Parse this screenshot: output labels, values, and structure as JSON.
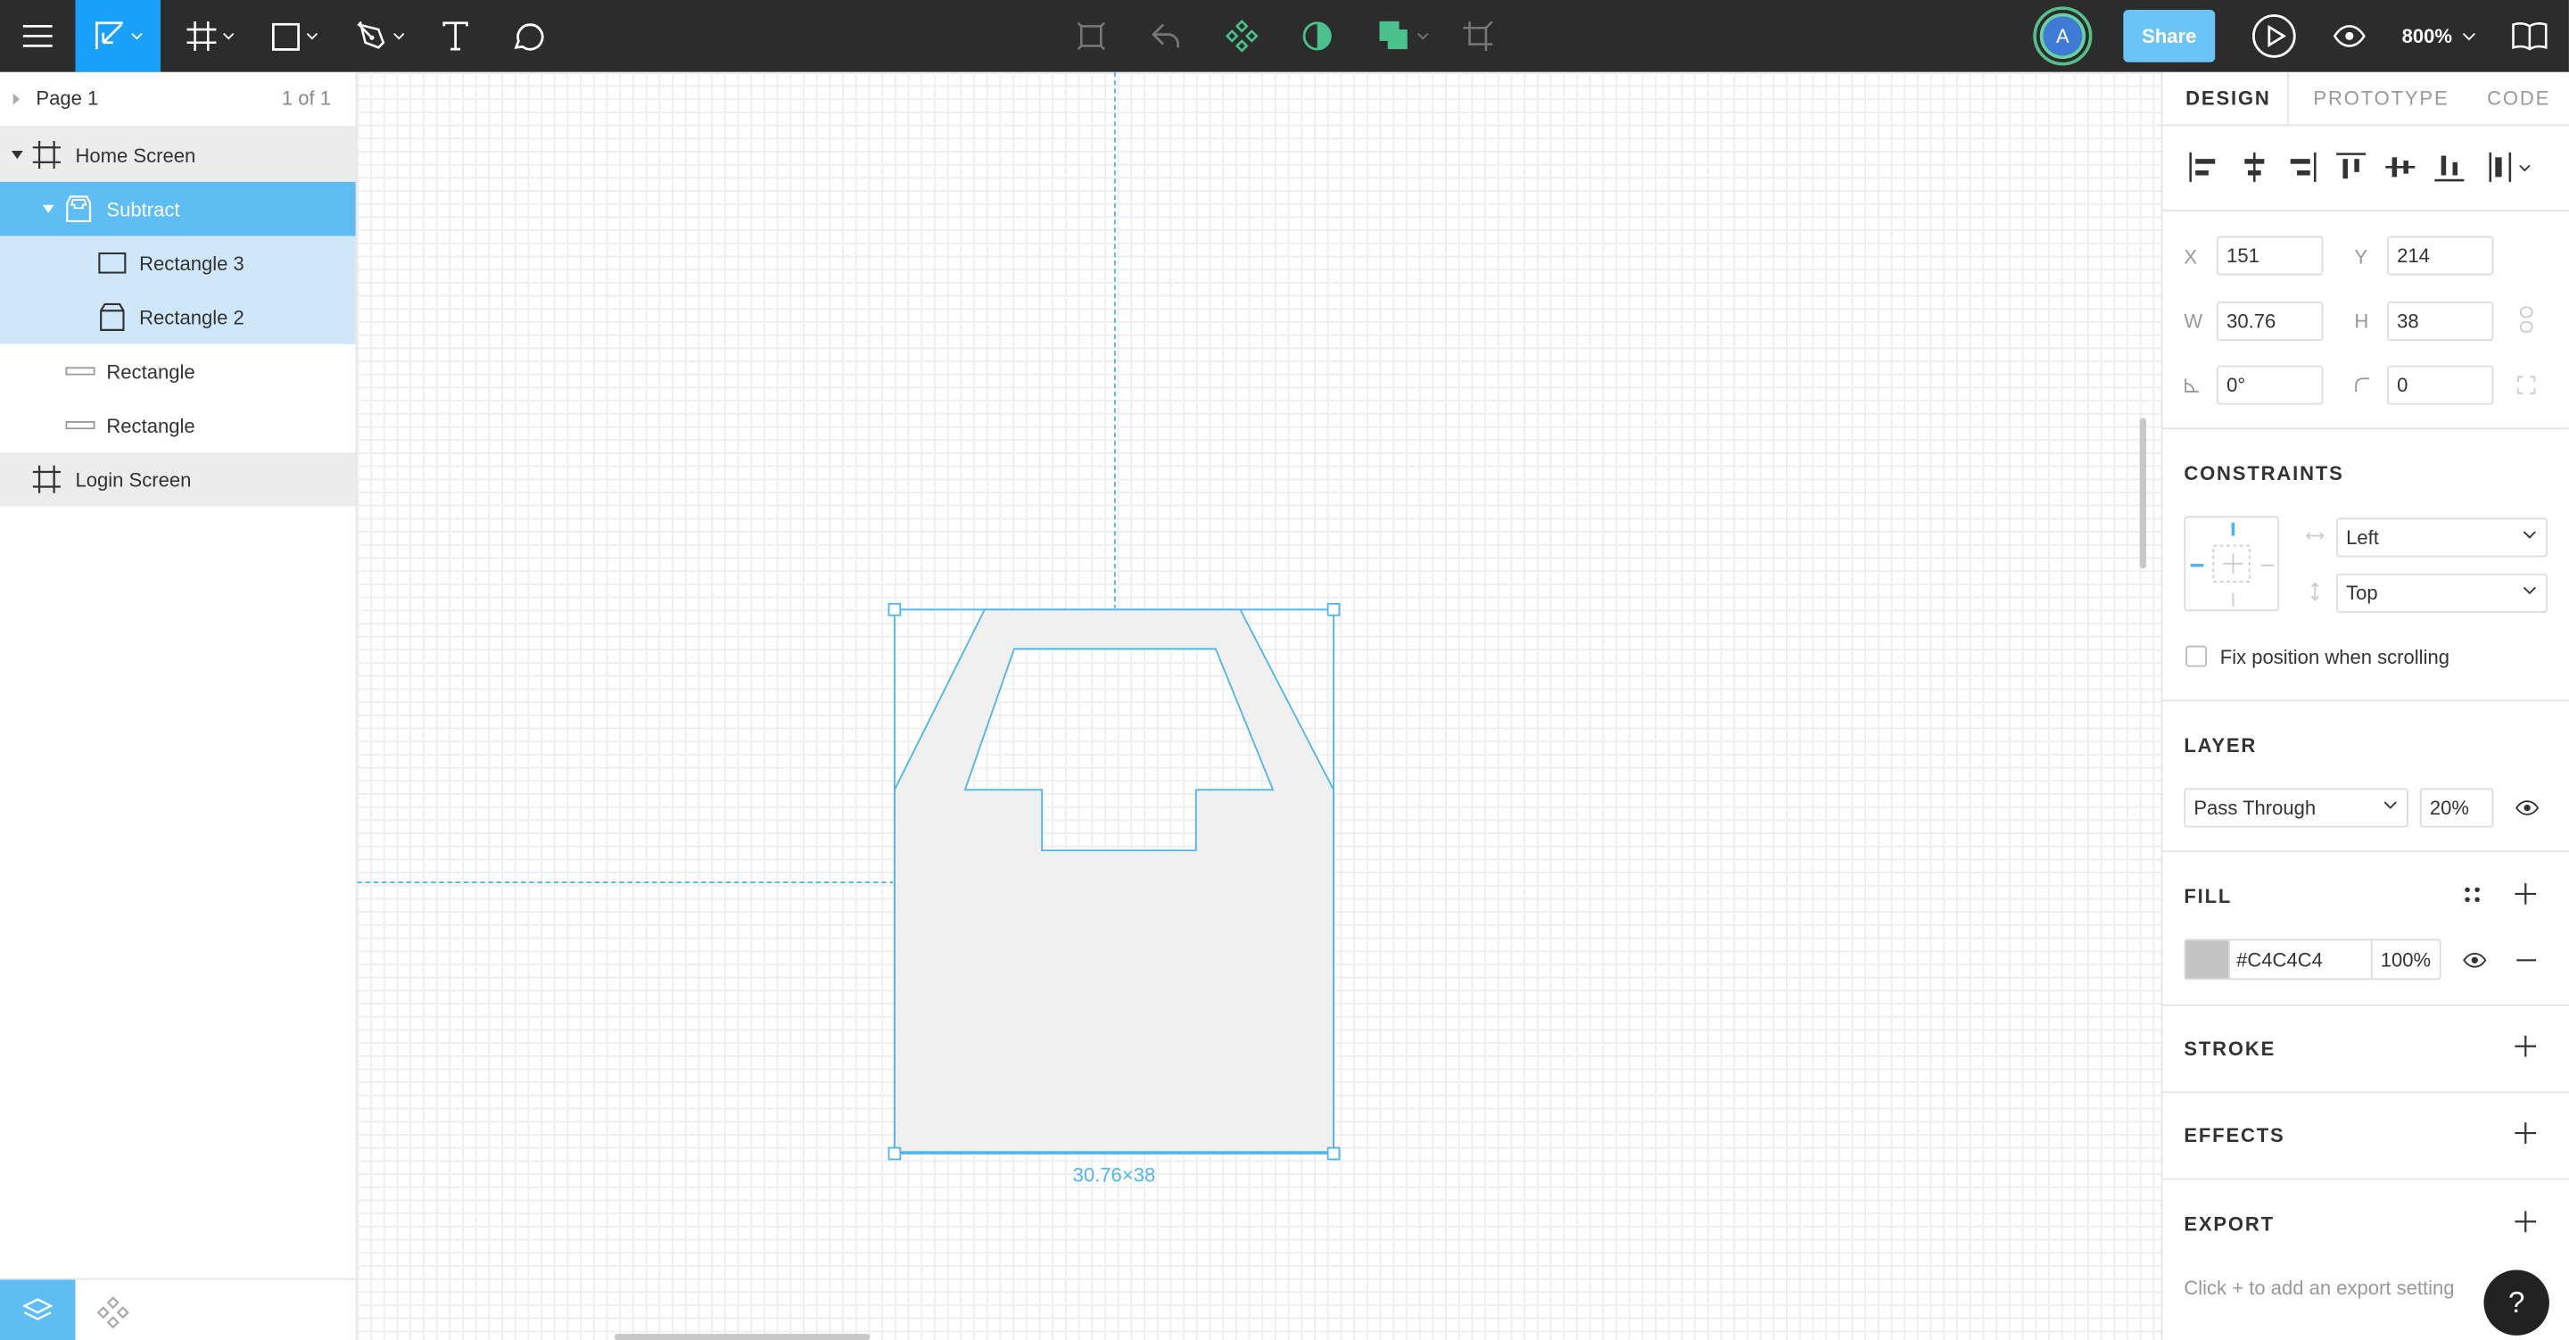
{
  "toolbar": {
    "zoom": "800%",
    "share_label": "Share",
    "avatar_initial": "A",
    "accent": "#2c2c2c",
    "active_tool_bg": "#18a0fb"
  },
  "pages": {
    "page_name": "Page 1",
    "page_count": "1 of 1"
  },
  "layers": [
    {
      "label": "Home Screen",
      "icon": "frame-icon",
      "state": "frame"
    },
    {
      "label": "Subtract",
      "icon": "boolean-icon",
      "state": "selected"
    },
    {
      "label": "Rectangle 3",
      "icon": "rectangle-icon",
      "state": "child"
    },
    {
      "label": "Rectangle 2",
      "icon": "rectangle-icon",
      "state": "child"
    },
    {
      "label": "Rectangle",
      "icon": "line-rect-icon",
      "state": "normal"
    },
    {
      "label": "Rectangle",
      "icon": "line-rect-icon",
      "state": "normal"
    },
    {
      "label": "Login Screen",
      "icon": "frame-icon",
      "state": "frame"
    }
  ],
  "canvas": {
    "dimension_label": "30.76×38",
    "selection_color": "#4fb6e8",
    "shape_fill": "#f0f0f0"
  },
  "design_panel": {
    "tabs": [
      "DESIGN",
      "PROTOTYPE",
      "CODE"
    ],
    "x_label": "X",
    "x_value": "151",
    "y_label": "Y",
    "y_value": "214",
    "w_label": "W",
    "w_value": "30.76",
    "h_label": "H",
    "h_value": "38",
    "rotation_value": "0°",
    "radius_value": "0",
    "constraints_title": "CONSTRAINTS",
    "constraint_horizontal": "Left",
    "constraint_vertical": "Top",
    "fix_position_label": "Fix position when scrolling",
    "layer_title": "LAYER",
    "blend_mode": "Pass Through",
    "layer_opacity": "20%",
    "fill_title": "FILL",
    "fill_hex": "#C4C4C4",
    "fill_opacity": "100%",
    "fill_color": "#c4c4c4",
    "stroke_title": "STROKE",
    "effects_title": "EFFECTS",
    "export_title": "EXPORT",
    "export_hint": "Click + to add an export setting",
    "help_label": "?"
  }
}
